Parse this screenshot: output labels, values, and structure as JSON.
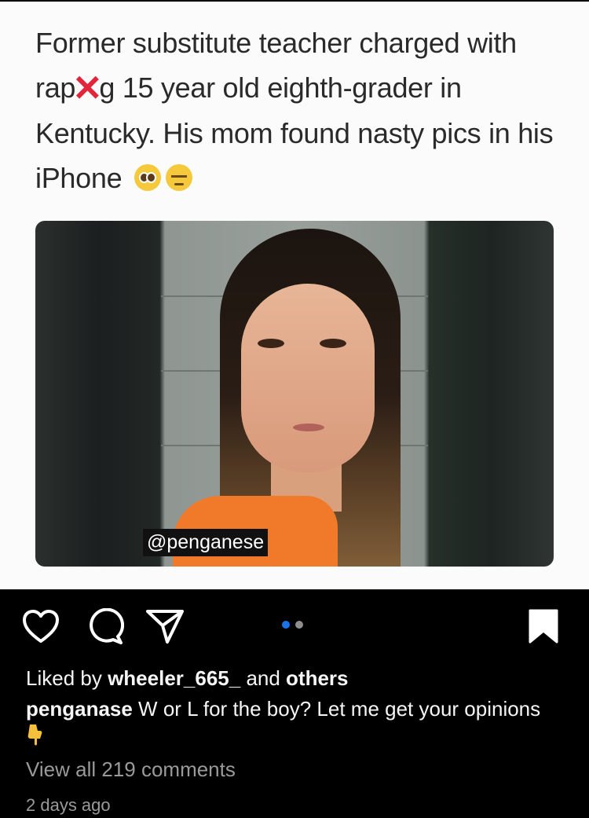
{
  "post": {
    "headline_before": "Former substitute teacher charged with rap",
    "headline_cross": "✕",
    "headline_after": "g 15 year old eighth-grader in Kentucky. His mom found nasty pics in his iPhone",
    "emojis": [
      "pleading-face",
      "pensive-face"
    ],
    "watermark": "@penganese"
  },
  "actions": {
    "icons": [
      "heart-icon",
      "comment-icon",
      "share-icon",
      "bookmark-icon"
    ],
    "carousel": {
      "count": 2,
      "active": 1,
      "active_color": "#1a73e8",
      "inactive_color": "#8e8e8e"
    }
  },
  "likes": {
    "prefix": "Liked by ",
    "user": "wheeler_665_",
    "middle": " and ",
    "others": "others"
  },
  "caption": {
    "username": "penganase",
    "text": " W or L for the boy? Let me get your opinions"
  },
  "comments_link": "View all 219 comments",
  "timestamp": "2 days ago"
}
